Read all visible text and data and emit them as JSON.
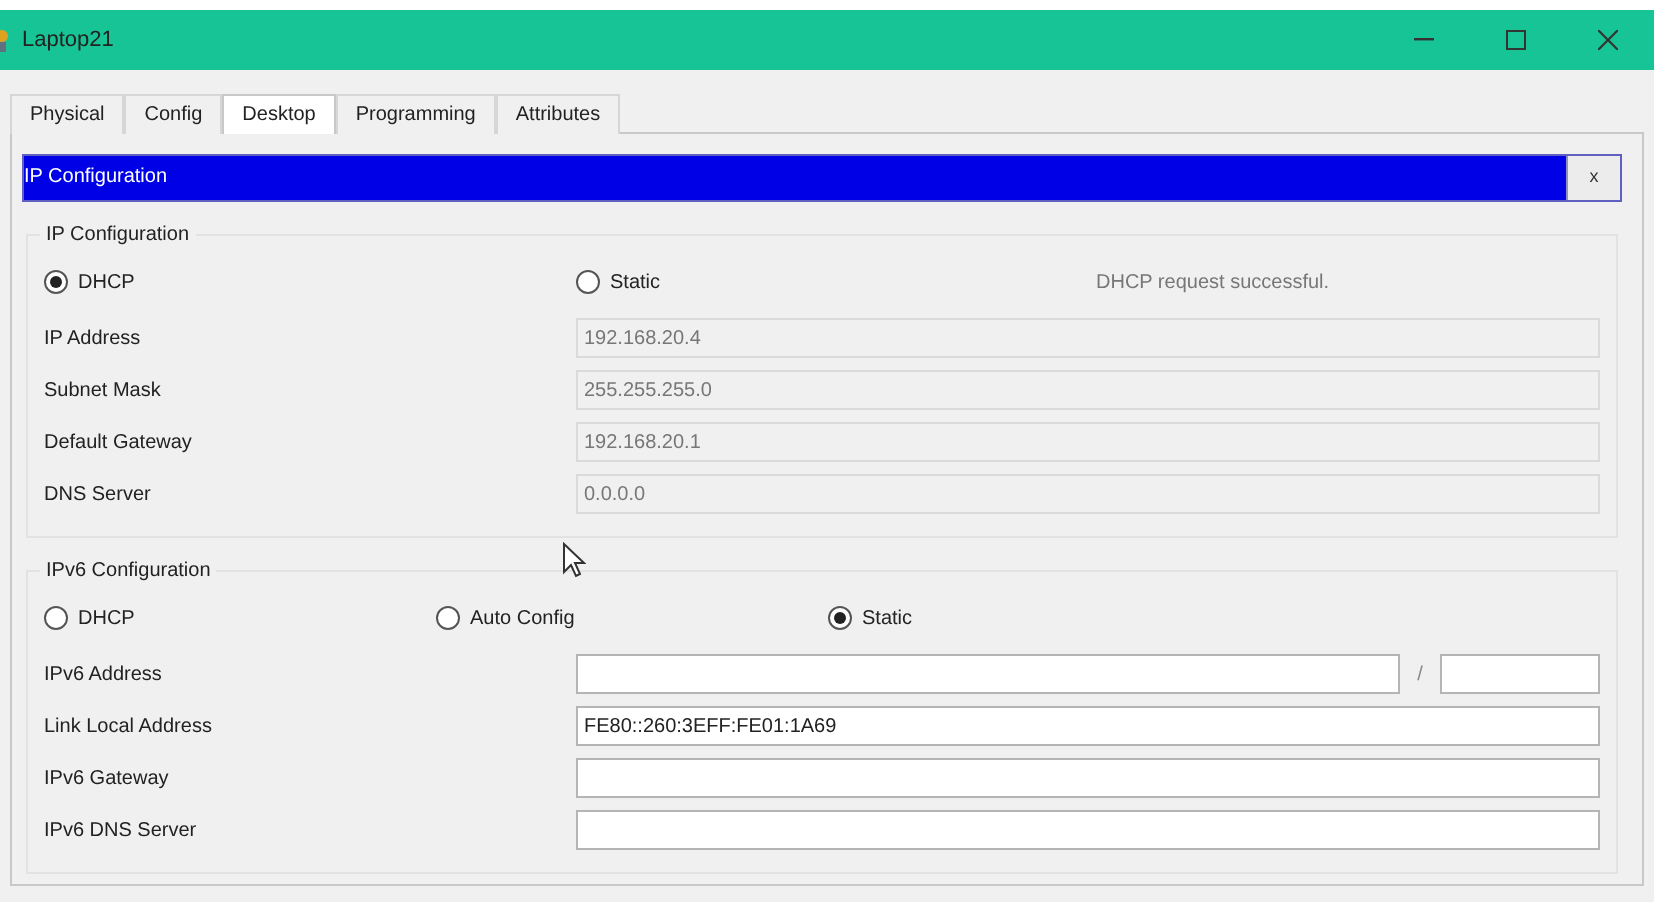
{
  "window": {
    "title": "Laptop21"
  },
  "tabs": [
    {
      "label": "Physical",
      "selected": false
    },
    {
      "label": "Config",
      "selected": false
    },
    {
      "label": "Desktop",
      "selected": true
    },
    {
      "label": "Programming",
      "selected": false
    },
    {
      "label": "Attributes",
      "selected": false
    }
  ],
  "dialog": {
    "title": "IP Configuration",
    "close_label": "x"
  },
  "ipv4": {
    "legend": "IP Configuration",
    "modes": [
      {
        "label": "DHCP",
        "selected": true
      },
      {
        "label": "Static",
        "selected": false
      }
    ],
    "status": "DHCP request successful.",
    "fields": [
      {
        "label": "IP Address",
        "value": "192.168.20.4",
        "disabled": true
      },
      {
        "label": "Subnet Mask",
        "value": "255.255.255.0",
        "disabled": true
      },
      {
        "label": "Default Gateway",
        "value": "192.168.20.1",
        "disabled": true
      },
      {
        "label": "DNS Server",
        "value": "0.0.0.0",
        "disabled": true
      }
    ]
  },
  "ipv6": {
    "legend": "IPv6 Configuration",
    "modes": [
      {
        "label": "DHCP",
        "selected": false
      },
      {
        "label": "Auto Config",
        "selected": false
      },
      {
        "label": "Static",
        "selected": true
      }
    ],
    "fields": [
      {
        "label": "IPv6 Address",
        "kind": "prefixed",
        "separator": "/",
        "disabled": false
      },
      {
        "label": "Link Local Address",
        "kind": "plain",
        "value": "FE80::260:3EFF:FE01:1A69",
        "disabled": false
      },
      {
        "label": "IPv6 Gateway",
        "kind": "plain",
        "disabled": false
      },
      {
        "label": "IPv6 DNS Server",
        "kind": "plain",
        "disabled": false
      }
    ]
  }
}
